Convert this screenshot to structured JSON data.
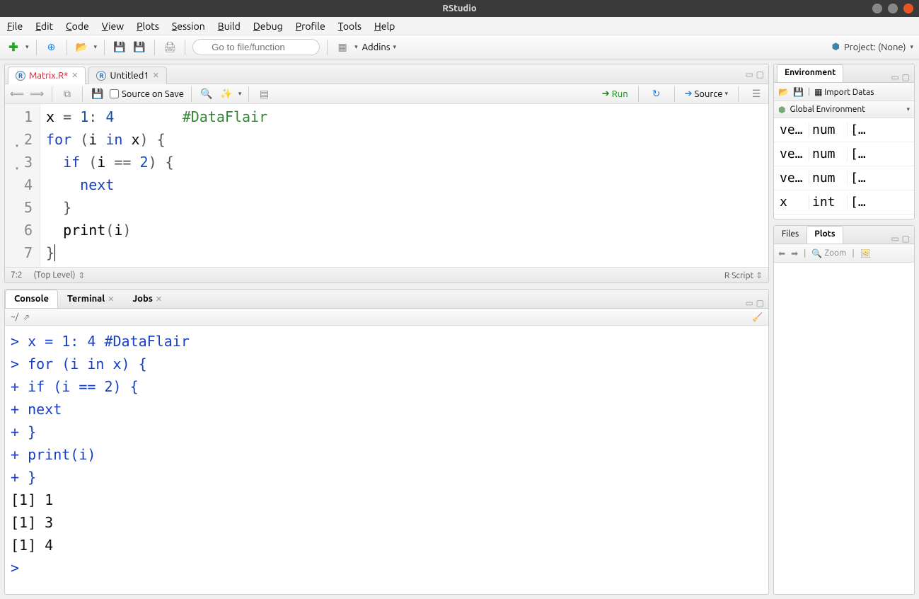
{
  "title": "RStudio",
  "menu": [
    "File",
    "Edit",
    "Code",
    "View",
    "Plots",
    "Session",
    "Build",
    "Debug",
    "Profile",
    "Tools",
    "Help"
  ],
  "toolbar": {
    "goto_placeholder": "Go to file/function",
    "addins_label": "Addins"
  },
  "project": {
    "label": "Project: (None)"
  },
  "source": {
    "tabs": [
      {
        "icon": "R",
        "name": "Matrix.R*",
        "dirty": true
      },
      {
        "icon": "R",
        "name": "Untitled1",
        "dirty": false
      }
    ],
    "source_on_save": "Source on Save",
    "run_label": "Run",
    "source_label": "Source",
    "code_lines": [
      {
        "n": "1",
        "fold": false,
        "html": "x <span class='tok-op'>=</span> <span class='tok-num'>1</span><span class='tok-op'>:</span> <span class='tok-num'>4</span>        <span class='tok-comment'>#DataFlair</span>"
      },
      {
        "n": "2",
        "fold": true,
        "html": "<span class='tok-kw'>for</span> <span class='tok-paren'>(</span>i <span class='tok-kw'>in</span> x<span class='tok-paren'>)</span> <span class='tok-paren'>{</span>"
      },
      {
        "n": "3",
        "fold": true,
        "html": "  <span class='tok-kw'>if</span> <span class='tok-paren'>(</span>i <span class='tok-op'>==</span> <span class='tok-num'>2</span><span class='tok-paren'>)</span> <span class='tok-paren'>{</span>"
      },
      {
        "n": "4",
        "fold": false,
        "html": "    <span class='tok-kw'>next</span>"
      },
      {
        "n": "5",
        "fold": false,
        "html": "  <span class='tok-paren'>}</span>"
      },
      {
        "n": "6",
        "fold": false,
        "html": "  print<span class='tok-paren'>(</span>i<span class='tok-paren'>)</span>"
      },
      {
        "n": "7",
        "fold": false,
        "html": "<span class='tok-paren'>}</span><span class='cursor-line'></span>"
      }
    ],
    "status_pos": "7:2",
    "status_scope": "(Top Level)",
    "status_type": "R Script"
  },
  "console": {
    "tabs": [
      "Console",
      "Terminal",
      "Jobs"
    ],
    "active_tab": 0,
    "path_label": "~/",
    "lines": [
      {
        "type": "in",
        "prompt": ">",
        "text": "x = 1: 4        #DataFlair"
      },
      {
        "type": "in",
        "prompt": ">",
        "text": "for (i in x) {"
      },
      {
        "type": "in",
        "prompt": "+",
        "text": "  if (i == 2) {"
      },
      {
        "type": "in",
        "prompt": "+",
        "text": "    next"
      },
      {
        "type": "in",
        "prompt": "+",
        "text": "  }"
      },
      {
        "type": "in",
        "prompt": "+",
        "text": "  print(i)"
      },
      {
        "type": "in",
        "prompt": "+",
        "text": "}"
      },
      {
        "type": "out",
        "text": "[1] 1"
      },
      {
        "type": "out",
        "text": "[1] 3"
      },
      {
        "type": "out",
        "text": "[1] 4"
      },
      {
        "type": "in",
        "prompt": ">",
        "text": " "
      }
    ]
  },
  "env": {
    "tab": "Environment",
    "import_label": "Import Datas",
    "scope": "Global Environment",
    "rows": [
      {
        "name": "ve…",
        "type": "num",
        "val": "[…"
      },
      {
        "name": "ve…",
        "type": "num",
        "val": "[…"
      },
      {
        "name": "ve…",
        "type": "num",
        "val": "[…"
      },
      {
        "name": "x",
        "type": "int",
        "val": "[…"
      }
    ]
  },
  "plots": {
    "tabs": [
      "Files",
      "Plots"
    ],
    "active": 1,
    "zoom": "Zoom"
  }
}
